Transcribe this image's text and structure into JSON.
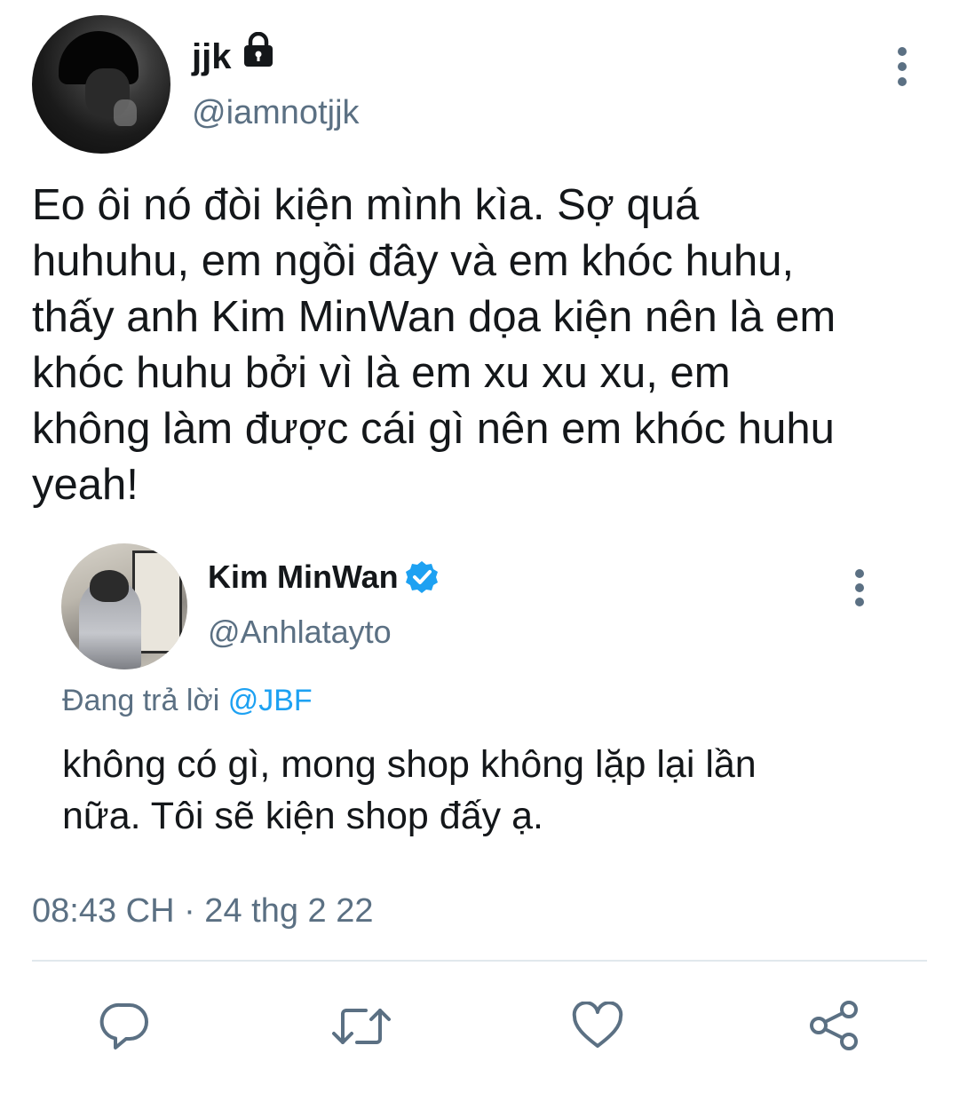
{
  "tweet": {
    "author_name": "jjk",
    "author_handle": "@iamnotjjk",
    "locked": true,
    "text": "Eo ôi nó đòi kiện mình kìa. Sợ quá\nhuhuhu, em ngồi đây và em khóc huhu,\nthấy anh Kim MinWan dọa kiện nên là em\nkhóc huhu bởi vì là em xu xu xu, em\nkhông làm được cái gì nên em khóc huhu\nyeah!",
    "timestamp": "08:43 CH · 24 thg 2 22"
  },
  "quoted_tweet": {
    "author_name": "Kim MinWan",
    "author_handle": "@Anhlatayto",
    "verified": true,
    "reply_prefix": "Đang trả lời ",
    "reply_mention": "@JBF",
    "text": "không có gì, mong shop không lặp lại lần\nnữa. Tôi sẽ kiện shop đấy ạ."
  },
  "actions": [
    {
      "icon": "reply-icon"
    },
    {
      "icon": "retweet-icon"
    },
    {
      "icon": "like-icon"
    },
    {
      "icon": "share-icon"
    }
  ],
  "colors": {
    "text": "#14171a",
    "secondary": "#5b7083",
    "accent": "#1da1f2",
    "divider": "#e1e8ed"
  }
}
